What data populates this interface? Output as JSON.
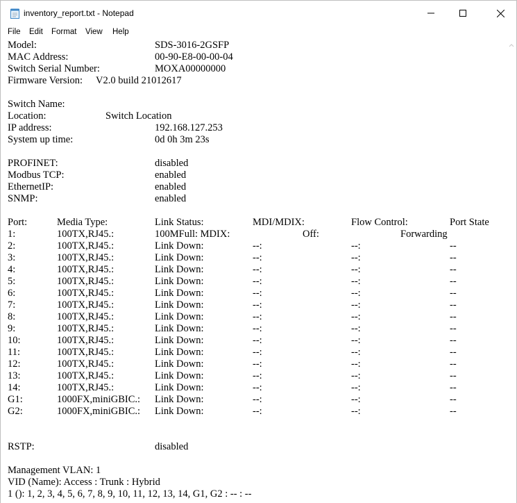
{
  "window": {
    "title": "inventory_report.txt - Notepad",
    "icon": "notepad-icon",
    "controls": [
      "minimize-icon",
      "maximize-icon",
      "close-icon"
    ]
  },
  "menu": [
    "File",
    "Edit",
    "Format",
    "View",
    "Help"
  ],
  "info": [
    {
      "label": "Model:",
      "value": "SDS-3016-2GSFP"
    },
    {
      "label": "MAC Address:",
      "value": "00-90-E8-00-00-04"
    },
    {
      "label": "Switch Serial Number:",
      "value": "MOXA00000000"
    },
    {
      "label": "Firmware Version:",
      "value": "V2.0 build 21012617"
    }
  ],
  "info2": [
    {
      "label": "Switch Name:",
      "value": ""
    },
    {
      "label": "Location:",
      "value": "Switch Location"
    },
    {
      "label": "IP address:",
      "value": "192.168.127.253"
    },
    {
      "label": "System up time:",
      "value": "0d 0h 3m 23s"
    }
  ],
  "protocols": [
    {
      "label": "PROFINET:",
      "value": "disabled"
    },
    {
      "label": "Modbus TCP:",
      "value": "enabled"
    },
    {
      "label": "EthernetIP:",
      "value": "enabled"
    },
    {
      "label": "SNMP:",
      "value": "enabled"
    }
  ],
  "port_table": {
    "headers": [
      "Port:",
      "Media Type:",
      "Link Status:",
      "MDI/MDIX:",
      "Flow Control:",
      "Port State"
    ],
    "rows": [
      [
        "1:",
        "100TX,RJ45.:",
        "100MFull: MDIX:",
        "",
        "Off:",
        "Forwarding"
      ],
      [
        "2:",
        "100TX,RJ45.:",
        "Link Down:",
        "--:",
        "--:",
        "--"
      ],
      [
        "3:",
        "100TX,RJ45.:",
        "Link Down:",
        "--:",
        "--:",
        "--"
      ],
      [
        "4:",
        "100TX,RJ45.:",
        "Link Down:",
        "--:",
        "--:",
        "--"
      ],
      [
        "5:",
        "100TX,RJ45.:",
        "Link Down:",
        "--:",
        "--:",
        "--"
      ],
      [
        "6:",
        "100TX,RJ45.:",
        "Link Down:",
        "--:",
        "--:",
        "--"
      ],
      [
        "7:",
        "100TX,RJ45.:",
        "Link Down:",
        "--:",
        "--:",
        "--"
      ],
      [
        "8:",
        "100TX,RJ45.:",
        "Link Down:",
        "--:",
        "--:",
        "--"
      ],
      [
        "9:",
        "100TX,RJ45.:",
        "Link Down:",
        "--:",
        "--:",
        "--"
      ],
      [
        "10:",
        "100TX,RJ45.:",
        "Link Down:",
        "--:",
        "--:",
        "--"
      ],
      [
        "11:",
        "100TX,RJ45.:",
        "Link Down:",
        "--:",
        "--:",
        "--"
      ],
      [
        "12:",
        "100TX,RJ45.:",
        "Link Down:",
        "--:",
        "--:",
        "--"
      ],
      [
        "13:",
        "100TX,RJ45.:",
        "Link Down:",
        "--:",
        "--:",
        "--"
      ],
      [
        "14:",
        "100TX,RJ45.:",
        "Link Down:",
        "--:",
        "--:",
        "--"
      ],
      [
        "G1:",
        "1000FX,miniGBIC.:",
        "Link Down:",
        "--:",
        "--:",
        "--"
      ],
      [
        "G2:",
        "1000FX,miniGBIC.:",
        "Link Down:",
        "--:",
        "--:",
        "--"
      ]
    ]
  },
  "rstp": {
    "label": "RSTP:",
    "value": "disabled"
  },
  "vlan": {
    "mgmt": "Management VLAN:  1",
    "header": "VID (Name): Access : Trunk : Hybrid",
    "row": "1 (): 1, 2, 3, 4, 5, 6, 7, 8, 9, 10, 11, 12, 13, 14, G1, G2 : -- : --"
  }
}
